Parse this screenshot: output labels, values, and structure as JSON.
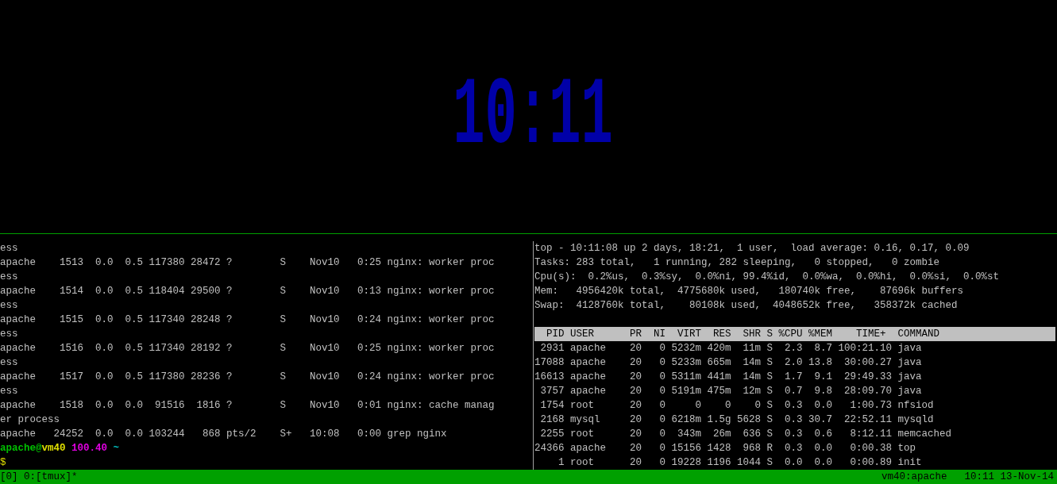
{
  "clock": {
    "time": "10:11",
    "color": "#0000a8"
  },
  "left_pane": {
    "lines": [
      "ess",
      "apache    1513  0.0  0.5 117380 28472 ?        S    Nov10   0:25 nginx: worker proc",
      "ess",
      "apache    1514  0.0  0.5 118404 29500 ?        S    Nov10   0:13 nginx: worker proc",
      "ess",
      "apache    1515  0.0  0.5 117340 28248 ?        S    Nov10   0:24 nginx: worker proc",
      "ess",
      "apache    1516  0.0  0.5 117340 28192 ?        S    Nov10   0:25 nginx: worker proc",
      "ess",
      "apache    1517  0.0  0.5 117380 28236 ?        S    Nov10   0:24 nginx: worker proc",
      "ess",
      "apache    1518  0.0  0.0  91516  1816 ?        S    Nov10   0:01 nginx: cache manag",
      "er process",
      "apache   24252  0.0  0.0 103244   868 pts/2    S+   10:08   0:00 grep nginx"
    ],
    "prompt": [
      {
        "text": "apache@",
        "color": "#00c000"
      },
      {
        "text": "vm40 ",
        "color": "#e0e000"
      },
      {
        "text": "100.40 ",
        "color": "#e000e0"
      },
      {
        "text": "~",
        "color": "#00c0c0"
      }
    ],
    "cursor_line": {
      "text": "$",
      "color": "#e0e000"
    }
  },
  "right_pane": {
    "summary": [
      "top - 10:11:08 up 2 days, 18:21,  1 user,  load average: 0.16, 0.17, 0.09",
      "Tasks: 283 total,   1 running, 282 sleeping,   0 stopped,   0 zombie",
      "Cpu(s):  0.2%us,  0.3%sy,  0.0%ni, 99.4%id,  0.0%wa,  0.0%hi,  0.0%si,  0.0%st",
      "Mem:   4956420k total,  4775680k used,   180740k free,    87696k buffers",
      "Swap:  4128760k total,    80108k used,  4048652k free,   358372k cached"
    ],
    "table_header": "  PID USER      PR  NI  VIRT  RES  SHR S %CPU %MEM    TIME+  COMMAND",
    "rows": [
      " 2931 apache    20   0 5232m 420m  11m S  2.3  8.7 100:21.10 java",
      "17088 apache    20   0 5233m 665m  14m S  2.0 13.8  30:00.27 java",
      "16613 apache    20   0 5311m 441m  14m S  1.7  9.1  29:49.33 java",
      " 3757 apache    20   0 5191m 475m  12m S  0.7  9.8  28:09.70 java",
      " 1754 root      20   0     0    0    0 S  0.3  0.0   1:00.73 nfsiod",
      " 2168 mysql     20   0 6218m 1.5g 5628 S  0.3 30.7  22:52.11 mysqld",
      " 2255 root      20   0  343m  26m  636 S  0.3  0.6   8:12.11 memcached",
      "24366 apache    20   0 15156 1428  968 R  0.3  0.0   0:00.38 top",
      "    1 root      20   0 19228 1196 1044 S  0.0  0.0   0:00.89 init"
    ]
  },
  "status_bar": {
    "session": "[0] 0:[tmux]*",
    "host": "vm40:apache",
    "datetime": "10:11 13-Nov-14"
  }
}
